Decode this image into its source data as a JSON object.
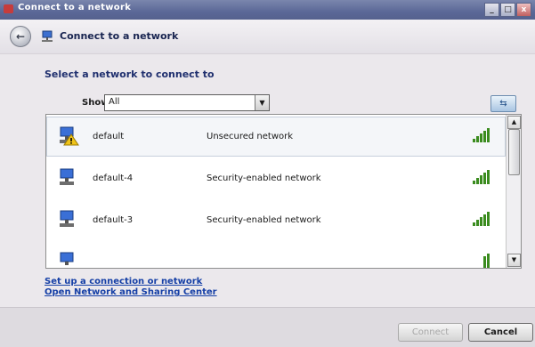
{
  "window": {
    "title": "Connect to a network",
    "min_glyph": "_",
    "max_glyph": "□",
    "close_glyph": "x"
  },
  "nav": {
    "back_glyph": "←",
    "title": "Connect to a network"
  },
  "main": {
    "heading": "Select a network to connect to",
    "show_label": "Show",
    "show_value": "All",
    "networks": [
      {
        "name": "default",
        "security": "Unsecured network",
        "icon": "network-warning-icon"
      },
      {
        "name": "default-4",
        "security": "Security-enabled network",
        "icon": "network-secure-icon"
      },
      {
        "name": "default-3",
        "security": "Security-enabled network",
        "icon": "network-secure-icon"
      }
    ]
  },
  "links": {
    "setup": "Set up a connection or network",
    "sharing_center": "Open Network and Sharing Center"
  },
  "footer": {
    "connect_label": "Connect",
    "cancel_label": "Cancel"
  },
  "colors": {
    "signal_green": "#3b8c1f",
    "link_blue": "#153fa6",
    "heading_blue": "#1f2f6e"
  }
}
